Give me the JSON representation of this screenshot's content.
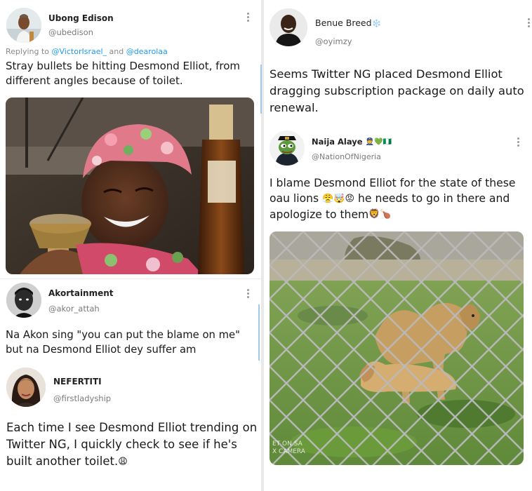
{
  "left": {
    "tweet1": {
      "name": "Ubong Edison",
      "handle": "@ubedison",
      "reply_prefix": "Replying to ",
      "reply_to_1": "@VictorIsrael_",
      "reply_and": " and ",
      "reply_to_2": "@dearolaa",
      "text": "Stray bullets be hitting Desmond Elliot, from different angles because of toilet."
    },
    "tweet2": {
      "name": "Akortainment",
      "handle": "@akor_attah",
      "text": "Na Akon sing \"you can put the blame on me\" but na Desmond Elliot dey suffer am"
    },
    "tweet3": {
      "name": "NEFERTITI",
      "handle": "@firstladyship",
      "text": "Each time I see Desmond Elliot trending on Twitter NG, I quickly check to see if he's built another toilet.",
      "emoji": "😩"
    }
  },
  "right": {
    "tweet1": {
      "name": "Benue Breed",
      "name_emoji": "❄️",
      "handle": "@oyimzy",
      "text": "Seems Twitter NG placed Desmond Elliot dragging subscription package on daily auto renewal."
    },
    "tweet2": {
      "name": "Naija Alaye",
      "name_emoji": "👮💚🇳🇬",
      "handle": "@NationOfNigeria",
      "text": "I blame Desmond Elliot for the state of these oau lions",
      "text_emoji": "😤🤯😡",
      "text_2": " he needs to go in there and apologize to them",
      "text_emoji_2": "🦁🍗"
    },
    "photo_watermark": "ET ON SA\nX CAMERA"
  },
  "colors": {
    "link": "#1d9bf0",
    "thread_line": "#9ec9ea",
    "handle": "#7a7a7a"
  }
}
